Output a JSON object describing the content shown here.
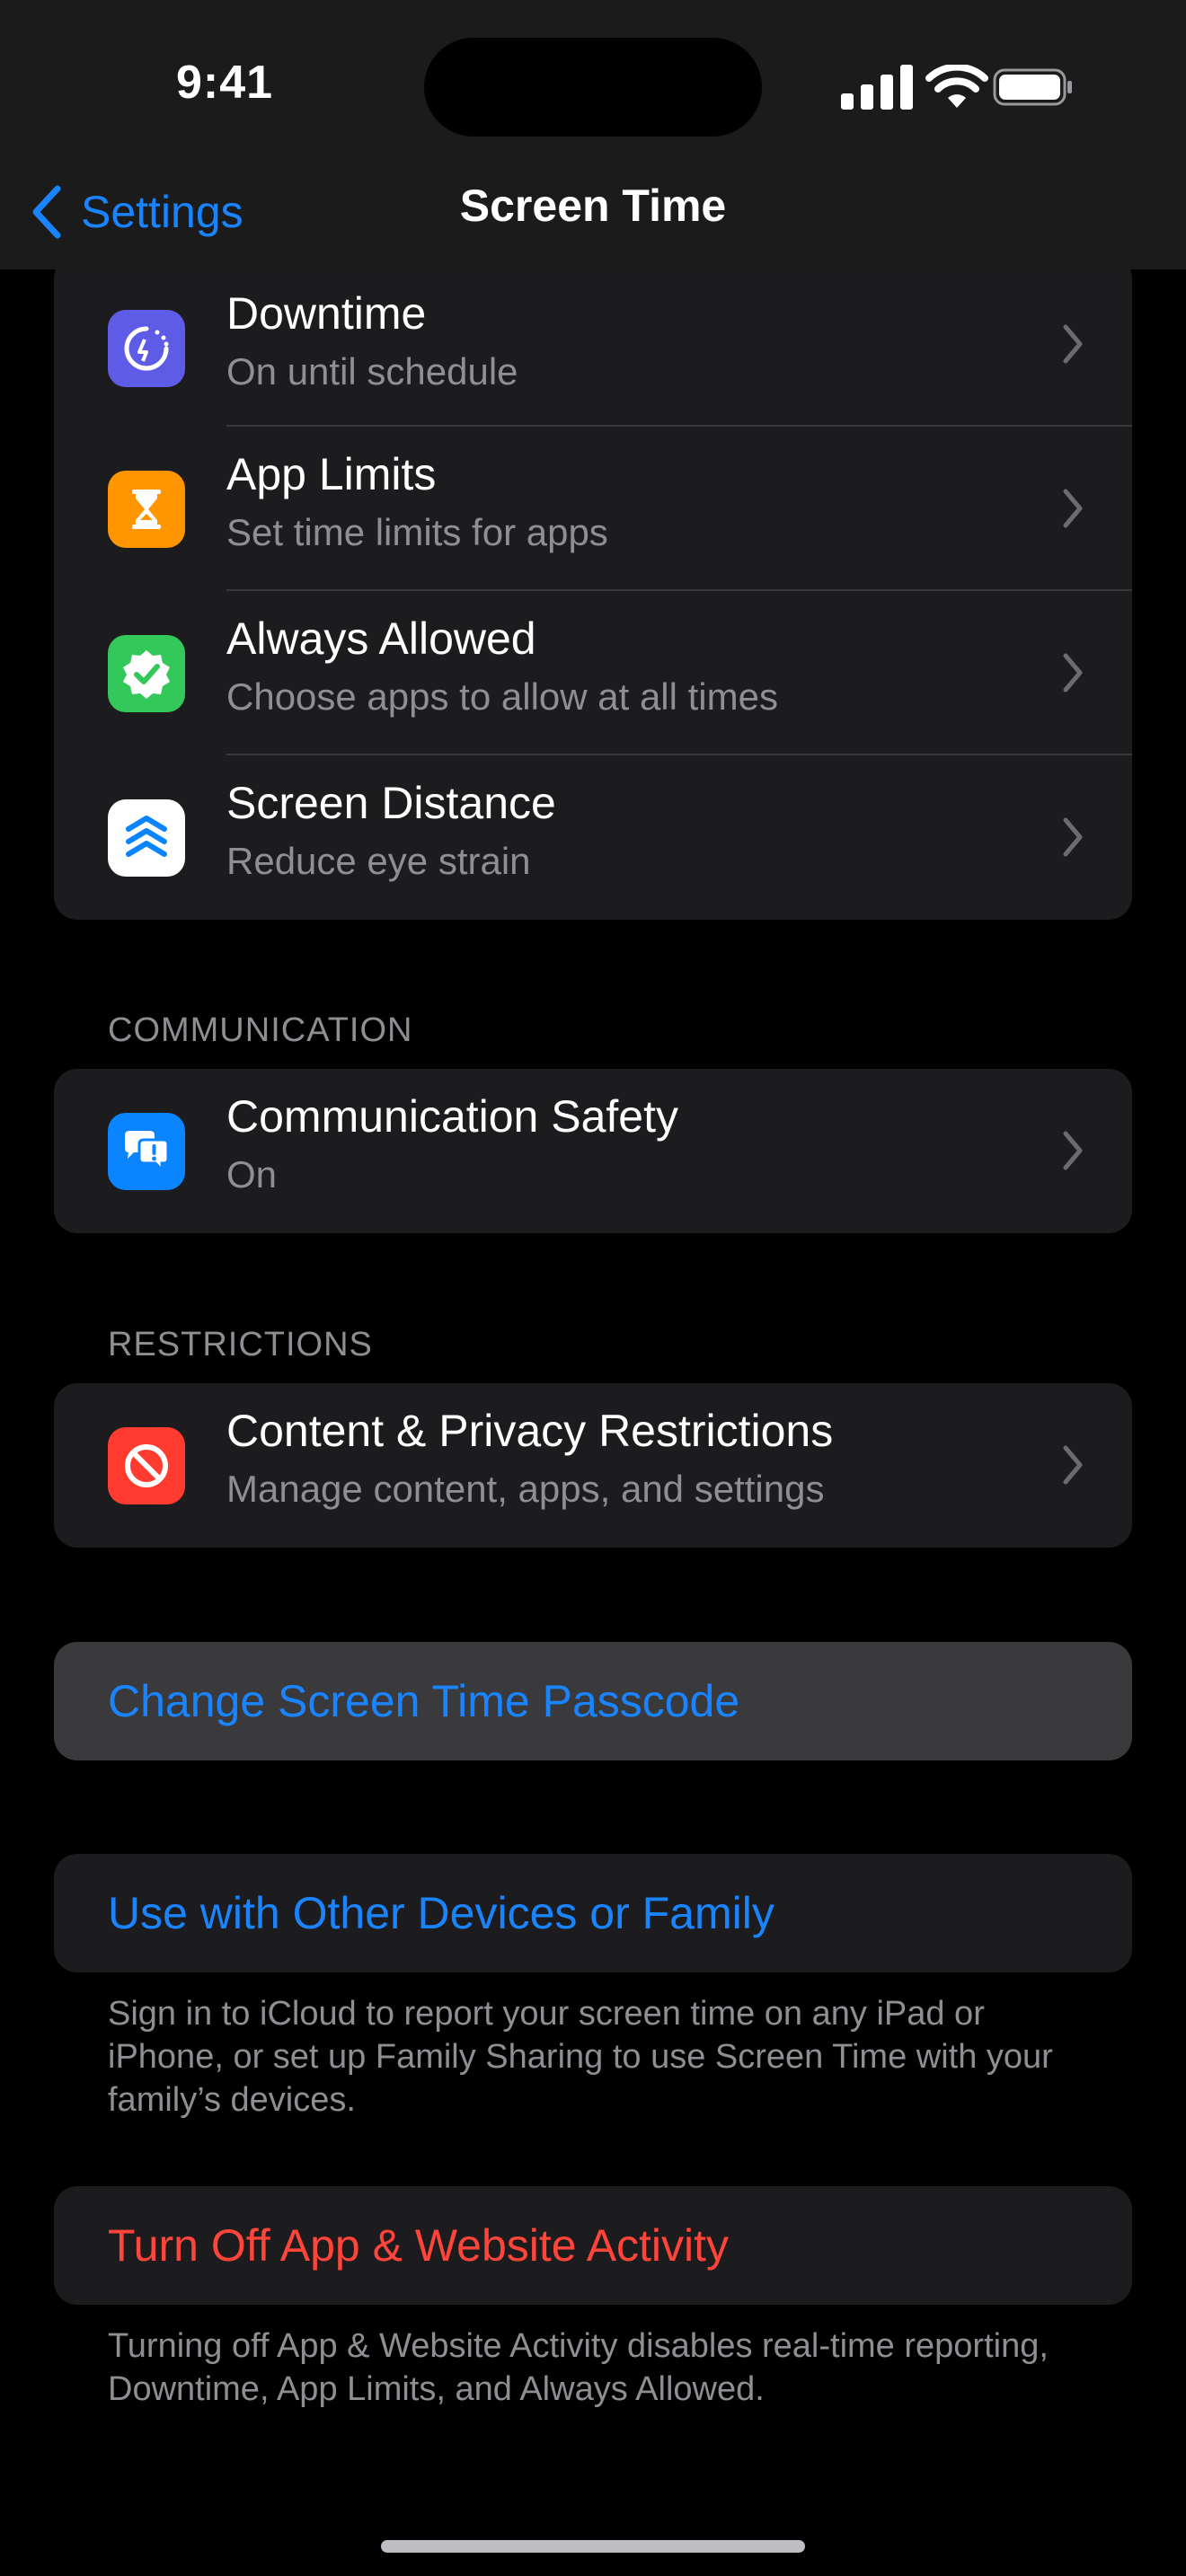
{
  "status": {
    "time": "9:41"
  },
  "nav": {
    "back_label": "Settings",
    "title": "Screen Time"
  },
  "limits_group": [
    {
      "title": "Downtime",
      "subtitle": "On until schedule",
      "icon": "downtime-icon",
      "color": "#5e5ce6"
    },
    {
      "title": "App Limits",
      "subtitle": "Set time limits for apps",
      "icon": "hourglass-icon",
      "color": "#ff9500"
    },
    {
      "title": "Always Allowed",
      "subtitle": "Choose apps to allow at all times",
      "icon": "checkmark-seal-icon",
      "color": "#34c759"
    },
    {
      "title": "Screen Distance",
      "subtitle": "Reduce eye strain",
      "icon": "chevrons-up-icon",
      "color": "#ffffff"
    }
  ],
  "communication": {
    "section_label": "COMMUNICATION",
    "items": [
      {
        "title": "Communication Safety",
        "subtitle": "On",
        "icon": "chat-bubbles-icon",
        "color": "#0a84ff"
      }
    ]
  },
  "restrictions": {
    "section_label": "RESTRICTIONS",
    "items": [
      {
        "title": "Content & Privacy Restrictions",
        "subtitle": "Manage content, apps, and settings",
        "icon": "restricted-icon",
        "color": "#ff3b30"
      }
    ]
  },
  "actions": {
    "change_passcode": "Change Screen Time Passcode",
    "use_with_other_devices": "Use with Other Devices or Family",
    "use_with_other_devices_footnote": "Sign in to iCloud to report your screen time on any iPad or iPhone, or set up Family Sharing to use Screen Time with your family’s devices.",
    "turn_off_activity": "Turn Off App & Website Activity",
    "turn_off_activity_footnote": "Turning off App & Website Activity disables real-time reporting, Downtime, App Limits, and Always Allowed."
  },
  "colors": {
    "accent": "#1a84ff",
    "destructive": "#ff453a",
    "highlight_row": "#3a3a3c"
  }
}
